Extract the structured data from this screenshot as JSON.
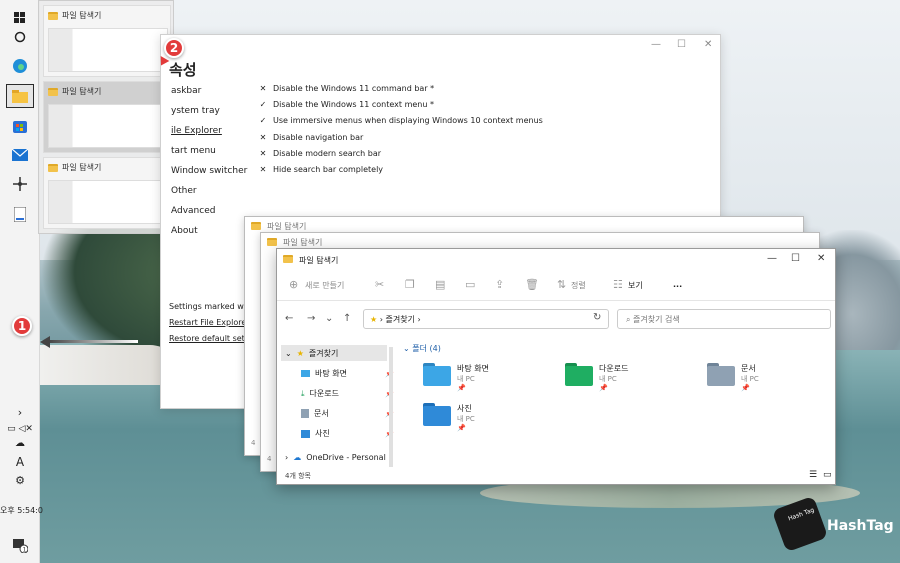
{
  "taskbar": {
    "clock": "오후 5:54:0"
  },
  "thumbnails": {
    "items": [
      {
        "title": "파일 탐색기"
      },
      {
        "title": "파일 탐색기"
      },
      {
        "title": "파일 탐색기"
      }
    ]
  },
  "callouts": {
    "one": "1",
    "two": "2"
  },
  "properties": {
    "title": "속성",
    "nav": [
      "askbar",
      "ystem tray",
      "ile Explorer",
      "tart menu",
      "Window switcher",
      "Other",
      "Advanced",
      "About"
    ],
    "options": [
      {
        "mark": "✕",
        "label": "Disable the Windows 11 command bar *"
      },
      {
        "mark": "✓",
        "label": "Disable the Windows 11 context menu *"
      },
      {
        "mark": "✓",
        "label": "Use immersive menus when displaying Windows 10 context menus"
      },
      {
        "mark": "✕",
        "label": "Disable navigation bar"
      },
      {
        "mark": "✕",
        "label": "Disable modern search bar"
      },
      {
        "mark": "✕",
        "label": "Hide search bar completely"
      }
    ],
    "footer_note": "Settings marked with",
    "restart_link": "Restart File Explorer",
    "restore_link": "Restore default setting"
  },
  "bg_windows": [
    {
      "title": "파일 탐색기"
    },
    {
      "title": "파일 탐색기"
    }
  ],
  "explorer": {
    "title": "파일 탐색기",
    "cmd": {
      "new": "새로 만들기",
      "sort": "정렬",
      "view": "보기",
      "more": "..."
    },
    "address": "즐겨찾기",
    "search_placeholder": "즐겨찾기 검색",
    "sidebar": {
      "favorites": "즐겨찾기",
      "items": [
        "바탕 화면",
        "다운로드",
        "문서",
        "사진"
      ],
      "onedrive": "OneDrive - Personal"
    },
    "section": "폴더 (4)",
    "tiles": [
      {
        "name": "바탕 화면",
        "sub": "내 PC"
      },
      {
        "name": "다운로드",
        "sub": "내 PC"
      },
      {
        "name": "문서",
        "sub": "내 PC"
      },
      {
        "name": "사진",
        "sub": "내 PC"
      }
    ],
    "status": "4개 항목",
    "bg_status": "4"
  },
  "logo": {
    "brand": "HashTag",
    "mini": "Hash Tag"
  }
}
